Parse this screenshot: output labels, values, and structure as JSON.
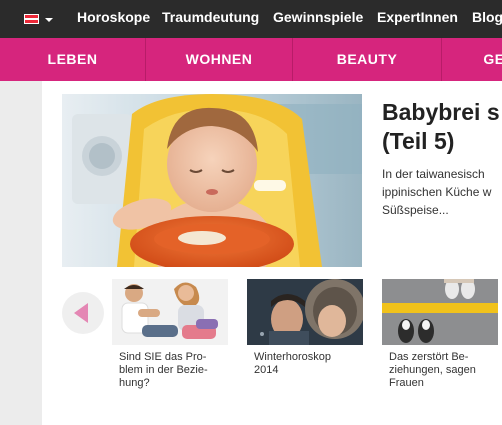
{
  "topnav": {
    "items": [
      "Horoskope",
      "Traumdeutung",
      "Gewinnspiele",
      "ExpertInnen",
      "Blogs"
    ]
  },
  "categories": [
    "LEBEN",
    "WOHNEN",
    "BEAUTY",
    "GE"
  ],
  "hero": {
    "headline_line1": "Babybrei s",
    "headline_line2": "(Teil 5)",
    "teaser_lines": [
      "In der taiwanesisch",
      "ippinischen Küche w",
      "Süßspeise..."
    ]
  },
  "carousel": {
    "items": [
      {
        "caption_lines": [
          "Sind SIE das Pro-",
          "blem in der Bezie-",
          "hung?"
        ]
      },
      {
        "caption_lines": [
          "Winterhoroskop",
          "2014"
        ]
      },
      {
        "caption_lines": [
          "Das zerstört Be-",
          "ziehungen, sagen",
          "Frauen"
        ]
      }
    ]
  },
  "colors": {
    "topbar": "#2b2b2b",
    "category_bar": "#d6257d",
    "accent_arrow": "#e487b4",
    "page_bg": "#ececec"
  }
}
